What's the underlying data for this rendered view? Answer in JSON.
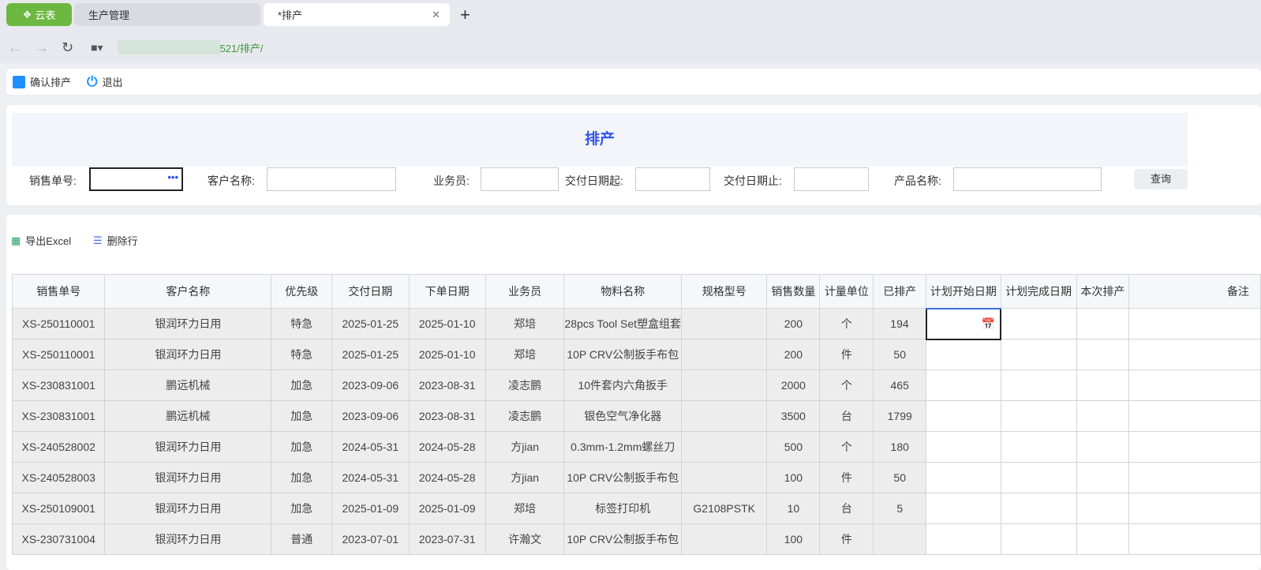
{
  "browser": {
    "tabs": [
      {
        "label": "云表"
      },
      {
        "label": "生产管理"
      },
      {
        "label": "*排产"
      }
    ],
    "url": "521/排产/"
  },
  "toolbar": {
    "confirm": "确认排产",
    "exit": "退出"
  },
  "form": {
    "title": "排产",
    "fields": {
      "order_no": "销售单号:",
      "customer": "客户名称:",
      "salesman": "业务员:",
      "date_from": "交付日期起:",
      "date_to": "交付日期止:",
      "product": "产品名称:"
    },
    "query": "查询"
  },
  "actions": {
    "export": "导出Excel",
    "delete_row": "删除行"
  },
  "table": {
    "headers": [
      "销售单号",
      "客户名称",
      "优先级",
      "交付日期",
      "下单日期",
      "业务员",
      "物料名称",
      "规格型号",
      "销售数量",
      "计量单位",
      "已排产",
      "计划开始日期",
      "计划完成日期",
      "本次排产",
      "备注"
    ],
    "rows": [
      [
        "XS-250110001",
        "银润环力日用",
        "特急",
        "2025-01-25",
        "2025-01-10",
        "郑培",
        "28pcs Tool Set塑盒组套",
        "",
        "200",
        "个",
        "194"
      ],
      [
        "XS-250110001",
        "银润环力日用",
        "特急",
        "2025-01-25",
        "2025-01-10",
        "郑培",
        "10P CRV公制扳手布包",
        "",
        "200",
        "件",
        "50"
      ],
      [
        "XS-230831001",
        "鹏远机械",
        "加急",
        "2023-09-06",
        "2023-08-31",
        "凌志鹏",
        "10件套内六角扳手",
        "",
        "2000",
        "个",
        "465"
      ],
      [
        "XS-230831001",
        "鹏远机械",
        "加急",
        "2023-09-06",
        "2023-08-31",
        "凌志鹏",
        "银色空气净化器",
        "",
        "3500",
        "台",
        "1799"
      ],
      [
        "XS-240528002",
        "银润环力日用",
        "加急",
        "2024-05-31",
        "2024-05-28",
        "方jian",
        "0.3mm-1.2mm螺丝刀",
        "",
        "500",
        "个",
        "180"
      ],
      [
        "XS-240528003",
        "银润环力日用",
        "加急",
        "2024-05-31",
        "2024-05-28",
        "方jian",
        "10P CRV公制扳手布包",
        "",
        "100",
        "件",
        "50"
      ],
      [
        "XS-250109001",
        "银润环力日用",
        "加急",
        "2025-01-09",
        "2025-01-09",
        "郑培",
        "标签打印机",
        "G2108PSTK",
        "10",
        "台",
        "5"
      ],
      [
        "XS-230731004",
        "银润环力日用",
        "普通",
        "2023-07-01",
        "2023-07-31",
        "许瀚文",
        "10P CRV公制扳手布包",
        "",
        "100",
        "件",
        ""
      ]
    ]
  }
}
